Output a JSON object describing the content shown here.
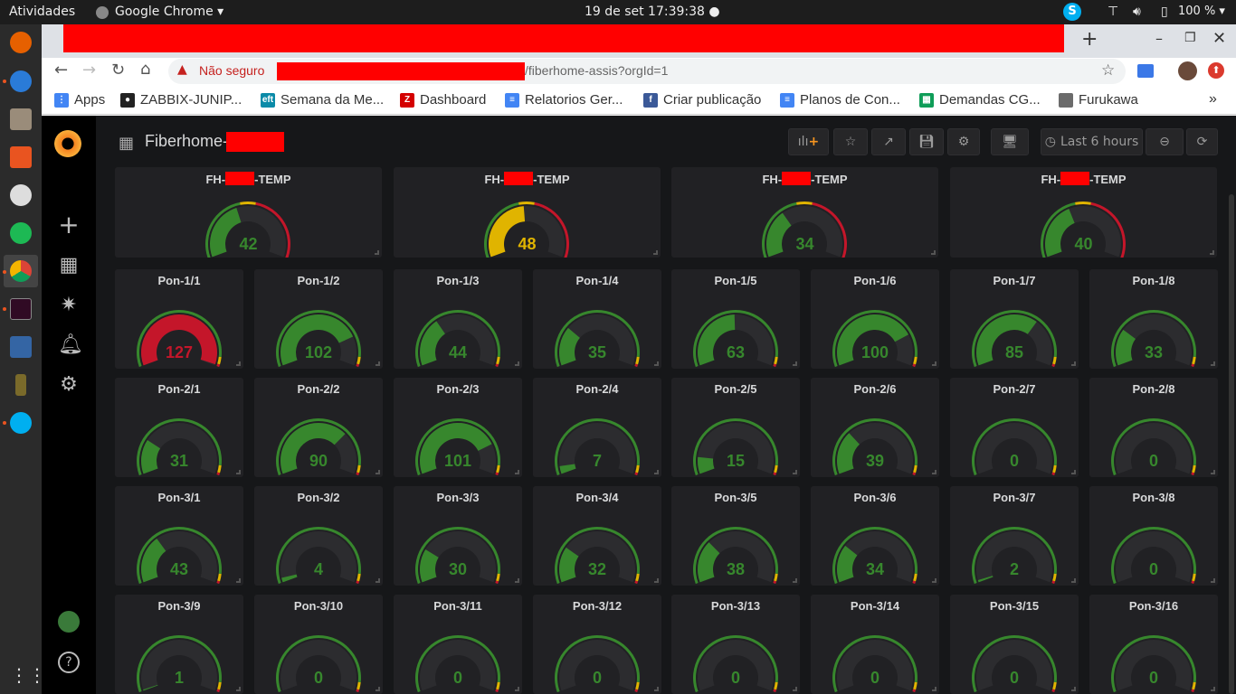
{
  "topbar": {
    "activities": "Atividades",
    "app": "Google Chrome ▾",
    "clock": "19 de set  17:39:38 ●",
    "battery": "100 % ▾"
  },
  "browser": {
    "insecure": "Não seguro",
    "url_suffix": "/fiberhome-assis?orgId=1"
  },
  "bookmarks": [
    {
      "label": "Apps",
      "icon": "apps-grid-icon",
      "color": "#4285f4",
      "glyph": "⋮"
    },
    {
      "label": "ZABBIX-JUNIP...",
      "icon": "github-icon",
      "color": "#222",
      "glyph": "●"
    },
    {
      "label": "Semana da Me...",
      "icon": "eft-icon",
      "color": "#0b8ba8",
      "glyph": "eft"
    },
    {
      "label": "Dashboard",
      "icon": "zabbix-icon",
      "color": "#d40000",
      "glyph": "Z"
    },
    {
      "label": "Relatorios Ger...",
      "icon": "docs-icon",
      "color": "#4285f4",
      "glyph": "≡"
    },
    {
      "label": "Criar publicação",
      "icon": "facebook-icon",
      "color": "#3b5998",
      "glyph": "f"
    },
    {
      "label": "Planos de Con...",
      "icon": "docs-icon",
      "color": "#4285f4",
      "glyph": "≡"
    },
    {
      "label": "Demandas CG...",
      "icon": "sheets-icon",
      "color": "#0f9d58",
      "glyph": "▦"
    },
    {
      "label": "Furukawa",
      "icon": "folder-icon",
      "color": "#6b6b6b",
      "glyph": ""
    }
  ],
  "dashboard": {
    "title": "Fiberhome-",
    "time_range": "Last 6 hours"
  },
  "colors": {
    "green": "#37872d",
    "yellow": "#e0b400",
    "red": "#c4162a",
    "track": "#2c2c2f"
  },
  "temp_gauges": [
    {
      "prefix": "FH-",
      "suffix": "-TEMP",
      "value": 42
    },
    {
      "prefix": "FH-",
      "suffix": "-TEMP",
      "value": 48
    },
    {
      "prefix": "FH-",
      "suffix": "-TEMP",
      "value": 34
    },
    {
      "prefix": "FH-",
      "suffix": "-TEMP",
      "value": 40
    }
  ],
  "temp_scale": {
    "min": 0,
    "max": 100,
    "yellow": 45,
    "red": 55
  },
  "pon_scale": {
    "min": 0,
    "max": 128,
    "yellow": 120,
    "red": 126
  },
  "pon_gauges": [
    {
      "label": "Pon-1/1",
      "value": 127
    },
    {
      "label": "Pon-1/2",
      "value": 102
    },
    {
      "label": "Pon-1/3",
      "value": 44
    },
    {
      "label": "Pon-1/4",
      "value": 35
    },
    {
      "label": "Pon-1/5",
      "value": 63
    },
    {
      "label": "Pon-1/6",
      "value": 100
    },
    {
      "label": "Pon-1/7",
      "value": 85
    },
    {
      "label": "Pon-1/8",
      "value": 33
    },
    {
      "label": "Pon-2/1",
      "value": 31
    },
    {
      "label": "Pon-2/2",
      "value": 90
    },
    {
      "label": "Pon-2/3",
      "value": 101
    },
    {
      "label": "Pon-2/4",
      "value": 7
    },
    {
      "label": "Pon-2/5",
      "value": 15
    },
    {
      "label": "Pon-2/6",
      "value": 39
    },
    {
      "label": "Pon-2/7",
      "value": 0
    },
    {
      "label": "Pon-2/8",
      "value": 0
    },
    {
      "label": "Pon-3/1",
      "value": 43
    },
    {
      "label": "Pon-3/2",
      "value": 4
    },
    {
      "label": "Pon-3/3",
      "value": 30
    },
    {
      "label": "Pon-3/4",
      "value": 32
    },
    {
      "label": "Pon-3/5",
      "value": 38
    },
    {
      "label": "Pon-3/6",
      "value": 34
    },
    {
      "label": "Pon-3/7",
      "value": 2
    },
    {
      "label": "Pon-3/8",
      "value": 0
    },
    {
      "label": "Pon-3/9",
      "value": 1
    },
    {
      "label": "Pon-3/10",
      "value": 0
    },
    {
      "label": "Pon-3/11",
      "value": 0
    },
    {
      "label": "Pon-3/12",
      "value": 0
    },
    {
      "label": "Pon-3/13",
      "value": 0
    },
    {
      "label": "Pon-3/14",
      "value": 0
    },
    {
      "label": "Pon-3/15",
      "value": 0
    },
    {
      "label": "Pon-3/16",
      "value": 0
    }
  ]
}
